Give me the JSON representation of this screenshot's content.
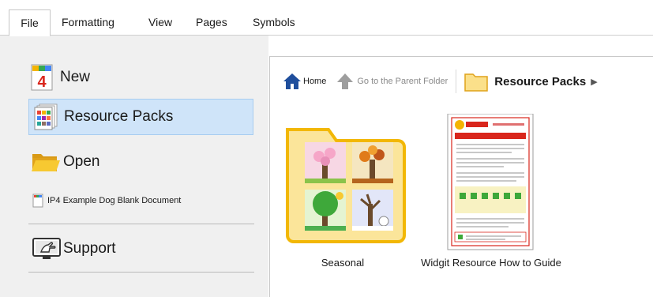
{
  "menu": {
    "file": "File",
    "formatting": "Formatting",
    "view": "View",
    "pages": "Pages",
    "symbols": "Symbols"
  },
  "sidebar": {
    "items": [
      {
        "label": "New",
        "icon": "new-document-icon"
      },
      {
        "label": "Resource Packs",
        "icon": "resource-packs-icon",
        "selected": true
      },
      {
        "label": "Open",
        "icon": "folder-open-icon"
      },
      {
        "label": "IP4 Example Dog Blank Document",
        "icon": "recent-document-icon"
      },
      {
        "label": "Support",
        "icon": "support-icon"
      }
    ]
  },
  "toolbar": {
    "home_label": "Home",
    "parent_label": "Go to the Parent Folder",
    "breadcrumb": "Resource Packs"
  },
  "tiles": [
    {
      "caption": "Seasonal",
      "icon": "seasonal-folder-icon"
    },
    {
      "caption": "Widgit Resource How to Guide",
      "icon": "document-thumbnail"
    }
  ],
  "colors": {
    "selected_bg": "#cfe4f9",
    "folder_yellow": "#f7c931",
    "home_blue": "#1f4e9c",
    "brand_red": "#d9261c"
  }
}
